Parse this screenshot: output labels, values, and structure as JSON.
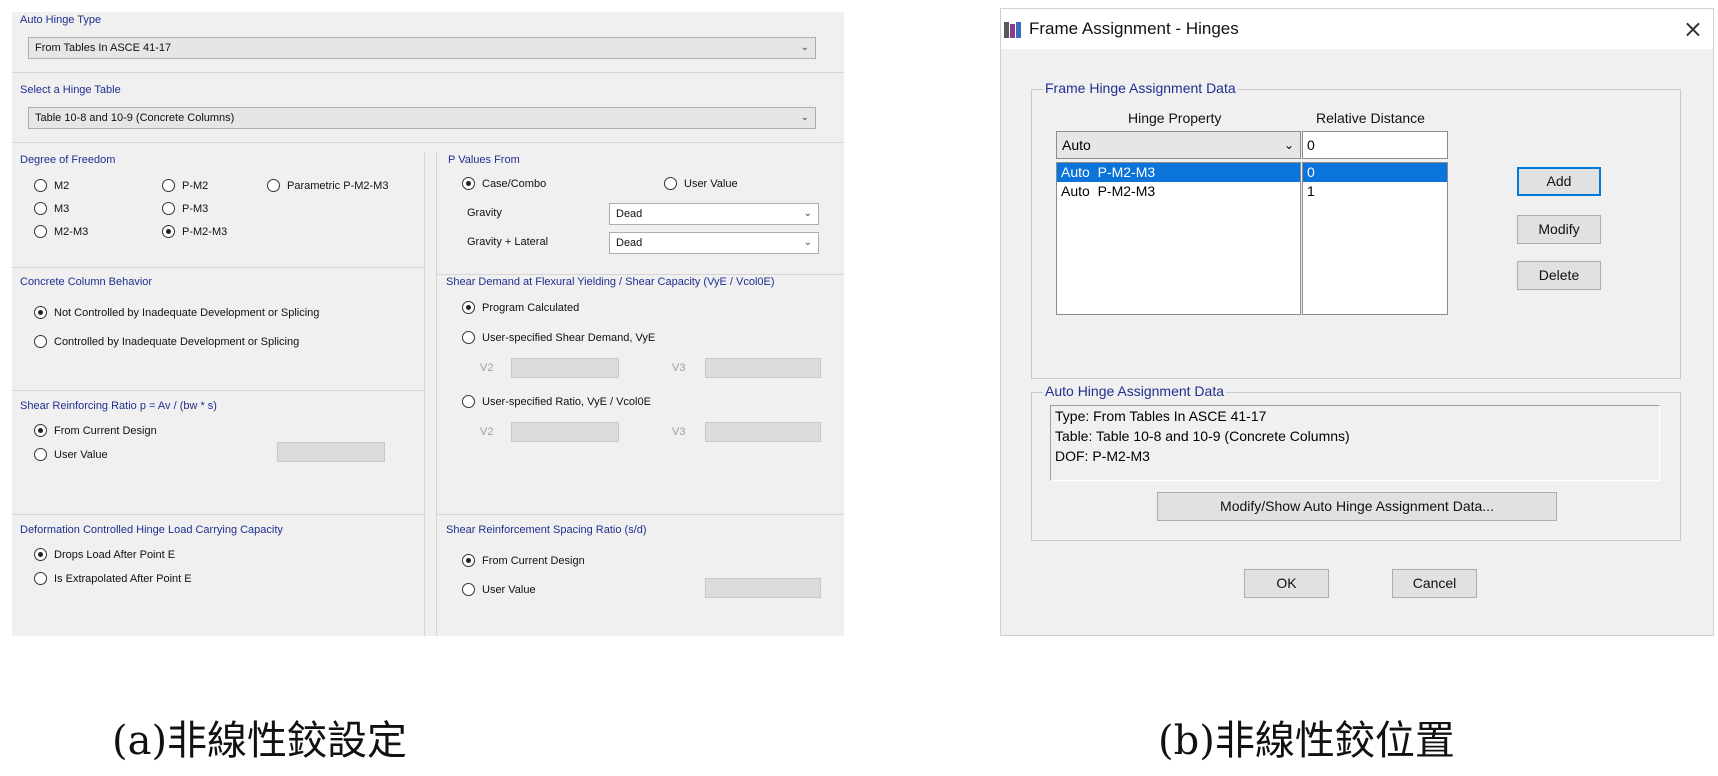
{
  "panel_a": {
    "auto_hinge_type": {
      "label": "Auto Hinge Type",
      "value": "From Tables In ASCE 41-17"
    },
    "hinge_table": {
      "label": "Select a Hinge Table",
      "value": "Table 10-8 and 10-9 (Concrete Columns)"
    },
    "dof": {
      "label": "Degree of Freedom",
      "options": [
        "M2",
        "M3",
        "M2-M3",
        "P-M2",
        "P-M3",
        "P-M2-M3",
        "Parametric P-M2-M3"
      ],
      "selected": "P-M2-M3"
    },
    "p_values": {
      "label": "P Values From",
      "case_combo": "Case/Combo",
      "user_value": "User Value",
      "gravity_label": "Gravity",
      "gravity_value": "Dead",
      "gravity_lateral_label": "Gravity + Lateral",
      "gravity_lateral_value": "Dead"
    },
    "concrete_behavior": {
      "label": "Concrete Column Behavior",
      "opt1": "Not Controlled by Inadequate Development or Splicing",
      "opt2": "Controlled by Inadequate Development or Splicing"
    },
    "shear_demand": {
      "label": "Shear Demand at Flexural Yielding / Shear Capacity (VyE / Vcol0E)",
      "opt1": "Program Calculated",
      "opt2": "User-specified Shear Demand, VyE",
      "opt3": "User-specified Ratio, VyE / Vcol0E",
      "v2": "V2",
      "v3": "V3"
    },
    "shear_ratio": {
      "label": "Shear Reinforcing Ratio p = Av / (bw * s)",
      "opt1": "From Current Design",
      "opt2": "User Value"
    },
    "deformation": {
      "label": "Deformation Controlled Hinge Load Carrying Capacity",
      "opt1": "Drops Load After Point E",
      "opt2": "Is Extrapolated After Point E"
    },
    "spacing_ratio": {
      "label": "Shear Reinforcement Spacing Ratio (s/d)",
      "opt1": "From Current Design",
      "opt2": "User Value"
    }
  },
  "panel_b": {
    "title": "Frame Assignment - Hinges",
    "frame_hinge": {
      "label": "Frame Hinge Assignment Data",
      "col_property": "Hinge Property",
      "col_distance": "Relative Distance",
      "property_value": "Auto",
      "distance_value": "0",
      "rows": [
        {
          "property": "Auto  P-M2-M3",
          "distance": "0"
        },
        {
          "property": "Auto  P-M2-M3",
          "distance": "1"
        }
      ],
      "add": "Add",
      "modify": "Modify",
      "delete": "Delete"
    },
    "auto_hinge": {
      "label": "Auto Hinge Assignment Data",
      "line1": "Type:  From Tables In ASCE 41-17",
      "line2": "Table:  Table 10-8 and 10-9 (Concrete Columns)",
      "line3": "DOF:  P-M2-M3",
      "button": "Modify/Show Auto Hinge Assignment Data..."
    },
    "ok": "OK",
    "cancel": "Cancel"
  },
  "captions": {
    "a": "(a)非線性鉸設定",
    "b": "(b)非線性鉸位置"
  }
}
